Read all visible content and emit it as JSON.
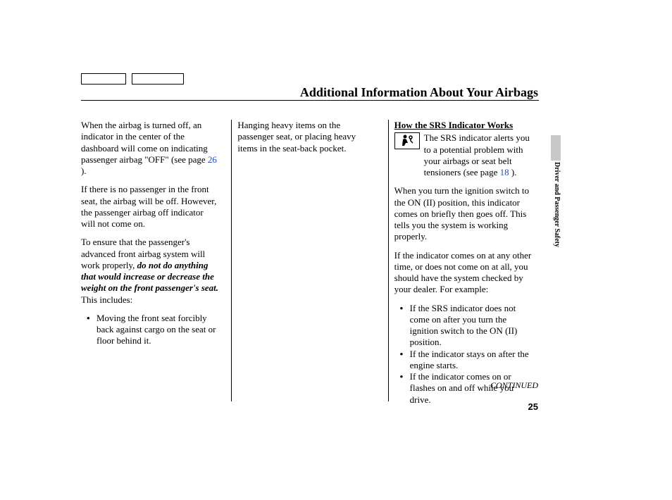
{
  "header": {
    "title": "Additional Information About Your Airbags"
  },
  "sidebar": {
    "section_label": "Driver and Passenger Safety"
  },
  "columns": {
    "left": {
      "p1_a": "When the airbag is turned off, an indicator in the center of the dashboard will come on indicating passenger airbag \"OFF\" (see page ",
      "p1_link": "26",
      "p1_b": " ).",
      "p2": "If there is no passenger in the front seat, the airbag will be off. However, the passenger airbag off indicator will not come on.",
      "p3_a": "To ensure that the passenger's advanced front airbag system will work properly, ",
      "p3_bold": "do not do anything that would increase or decrease the weight on the front passenger's seat.",
      "p3_b": " This includes:",
      "bullet1": "Moving the front seat forcibly back against cargo on the seat or floor behind it."
    },
    "middle": {
      "p1": "Hanging heavy items on the passenger seat, or placing heavy items in the seat-back pocket."
    },
    "right": {
      "heading": "How the SRS Indicator Works",
      "icon_name": "seatbelt-person-icon",
      "p1_a": "The SRS indicator alerts you to a potential problem with your airbags or seat belt tensioners (see page ",
      "p1_link": "18",
      "p1_b": " ).",
      "p2": "When you turn the ignition switch to the ON (II) position, this indicator comes on briefly then goes off. This tells you the system is working properly.",
      "p3": "If the indicator comes on at any other time, or does not come on at all, you should have the system checked by your dealer. For example:",
      "bullets": [
        "If the SRS indicator does not come on after you turn the ignition switch to the ON (II) position.",
        "If the indicator stays on after the engine starts.",
        "If the indicator comes on or flashes on and off while you drive."
      ]
    }
  },
  "footer": {
    "continued": "CONTINUED",
    "page_number": "25"
  }
}
